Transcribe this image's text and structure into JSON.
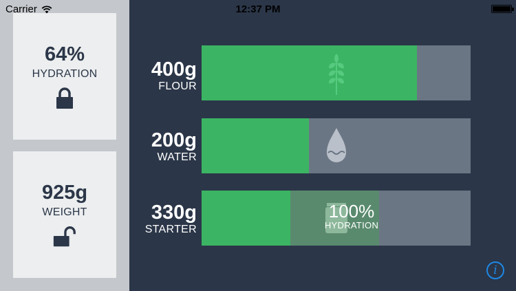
{
  "status_bar": {
    "carrier": "Carrier",
    "time": "12:37 PM"
  },
  "hydration_card": {
    "value": "64%",
    "label": "HYDRATION",
    "lock_state": "locked",
    "icon": "lock-icon"
  },
  "weight_card": {
    "value": "925g",
    "label": "WEIGHT",
    "lock_state": "unlocked",
    "icon": "unlock-icon"
  },
  "rows": {
    "flour": {
      "amount": "400g",
      "name": "FLOUR",
      "fill_fraction": 0.8,
      "icon": "wheat-icon"
    },
    "water": {
      "amount": "200g",
      "name": "WATER",
      "fill_fraction": 0.4,
      "icon": "water-drop-icon"
    },
    "starter": {
      "amount": "330g",
      "name": "STARTER",
      "fill_fraction": 0.33,
      "overlay_fraction": 0.33,
      "hydration_value": "100%",
      "hydration_label": "HYDRATION",
      "icon": "jar-icon"
    }
  },
  "colors": {
    "background": "#2b3648",
    "bar_fill": "#3bb563",
    "bar_track": "#6b7685",
    "info_accent": "#1e88e5"
  },
  "info_button": {
    "icon": "info-icon"
  }
}
